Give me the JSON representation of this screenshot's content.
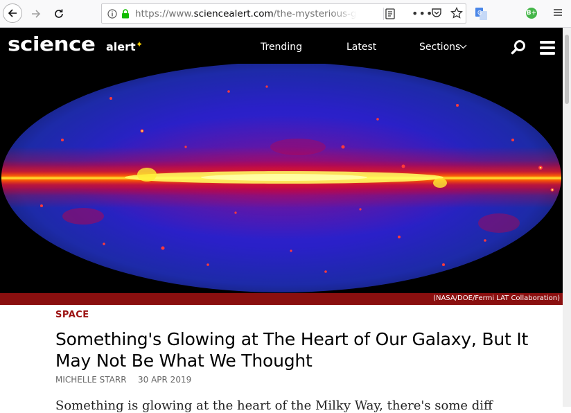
{
  "browser": {
    "url_prefix": "https://www.",
    "url_domain": "sciencealert.com",
    "url_path": "/the-mysterious-g",
    "more_label": "•••",
    "extension_b_label": "B+"
  },
  "site": {
    "logo_main": "science",
    "logo_sub": "alert",
    "nav": {
      "trending": "Trending",
      "latest": "Latest",
      "sections": "Sections"
    }
  },
  "hero": {
    "caption": "(NASA/DOE/Fermi LAT Collaboration)"
  },
  "article": {
    "category": "SPACE",
    "headline": "Something's Glowing at The Heart of Our Galaxy, But It May Not Be What We Thought",
    "author": "MICHELLE STARR",
    "date": "30 APR 2019",
    "first_line": "Something is glowing at the heart of the Milky Way, there's some diff"
  },
  "colors": {
    "category_red": "#9b1111",
    "caption_bar": "#8a0f0f",
    "header_bg": "#000000"
  }
}
